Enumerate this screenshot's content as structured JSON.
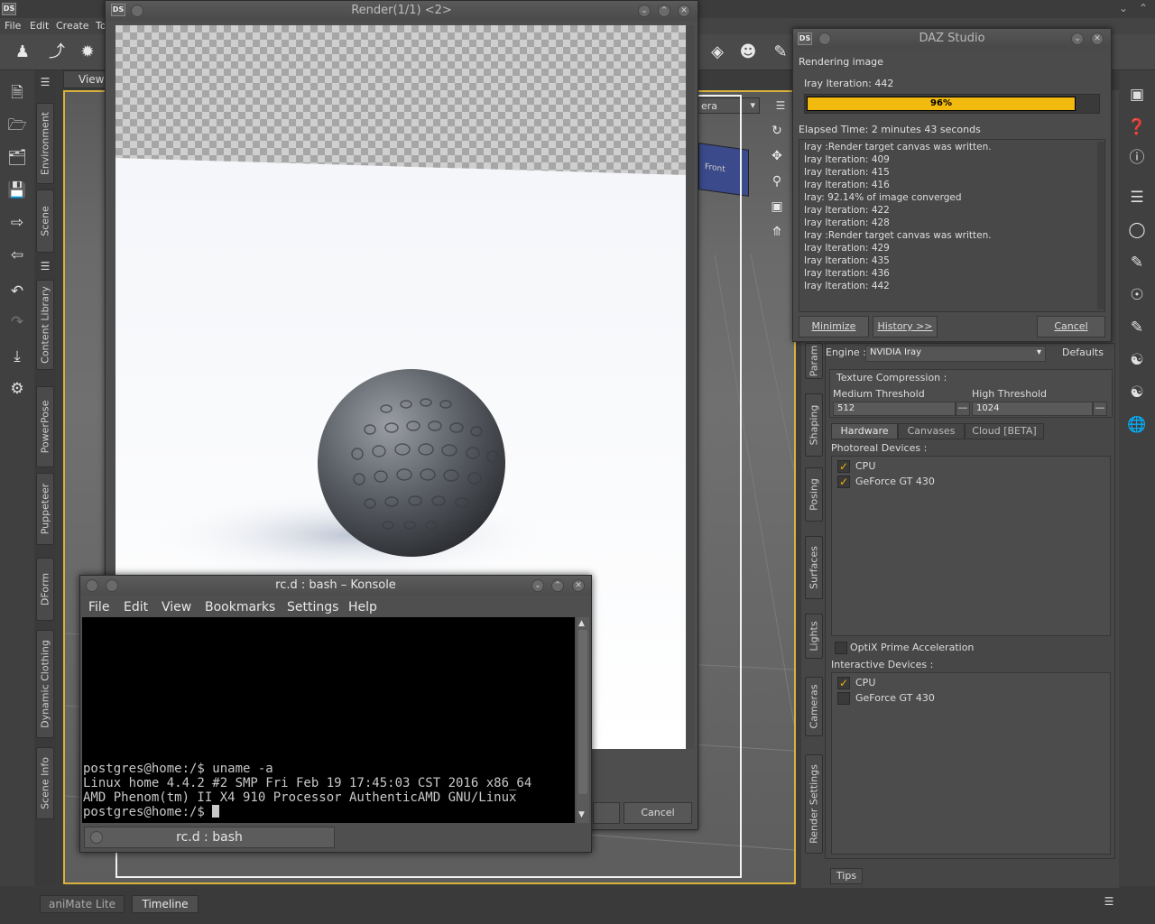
{
  "main": {
    "menu": [
      "File",
      "Edit",
      "Create",
      "Tools"
    ],
    "viewport_tab": "View",
    "camera_dropdown": "era",
    "left_tabs": [
      "Environment",
      "Scene",
      "Content Library",
      "PowerPose",
      "Puppeteer",
      "DForm",
      "Dynamic Clothing",
      "Scene Info"
    ],
    "right_tabs": [
      "Param",
      "Shaping",
      "Posing",
      "Surfaces",
      "Lights",
      "Cameras",
      "Render Settings"
    ],
    "bottom_tabs": [
      "aniMate Lite",
      "Timeline"
    ],
    "tips_tab": "Tips",
    "cube_label": "Front"
  },
  "render_window": {
    "title": "Render(1/1) <2>",
    "cancel": "Cancel"
  },
  "progress_dialog": {
    "title": "DAZ Studio",
    "status": "Rendering image",
    "iteration": "Iray Iteration: 442",
    "progress_percent": 96,
    "progress_label": "96%",
    "elapsed": "Elapsed Time:  2 minutes 43 seconds",
    "log": [
      "Iray :Render target canvas was written.",
      "Iray Iteration: 409",
      "Iray Iteration: 415",
      "Iray Iteration: 416",
      "Iray: 92.14% of image converged",
      "Iray Iteration: 422",
      "Iray Iteration: 428",
      "Iray :Render target canvas was written.",
      "Iray Iteration: 429",
      "Iray Iteration: 435",
      "Iray Iteration: 436",
      "Iray Iteration: 442"
    ],
    "btn_minimize": "Minimize",
    "btn_history": "History >>",
    "btn_cancel": "Cancel"
  },
  "render_settings": {
    "engine_label": "Engine :",
    "engine_value": "NVIDIA Iray",
    "defaults": "Defaults",
    "texture_compression": "Texture Compression :",
    "medium_threshold_label": "Medium Threshold",
    "medium_threshold_value": "512",
    "high_threshold_label": "High Threshold",
    "high_threshold_value": "1024",
    "subtabs": [
      "Hardware",
      "Canvases",
      "Cloud [BETA]"
    ],
    "photoreal_devices": "Photoreal Devices :",
    "photoreal_list": [
      {
        "name": "CPU",
        "checked": true
      },
      {
        "name": "GeForce GT 430",
        "checked": true
      }
    ],
    "optix": "OptiX Prime Acceleration",
    "interactive_devices": "Interactive Devices :",
    "interactive_list": [
      {
        "name": "CPU",
        "checked": true
      },
      {
        "name": "GeForce GT 430",
        "checked": false
      }
    ]
  },
  "konsole": {
    "title": "rc.d : bash – Konsole",
    "menu": [
      "File",
      "Edit",
      "View",
      "Bookmarks",
      "Settings",
      "Help"
    ],
    "lines": [
      "postgres@home:/$ uname -a",
      "Linux home 4.4.2 #2 SMP Fri Feb 19 17:45:03 CST 2016 x86_64",
      "AMD Phenom(tm) II X4 910 Processor AuthenticAMD GNU/Linux",
      "postgres@home:/$ "
    ],
    "tab_label": "rc.d : bash"
  },
  "colors": {
    "accent_yellow": "#f2b90f",
    "viewport_border": "#d9b23b"
  }
}
